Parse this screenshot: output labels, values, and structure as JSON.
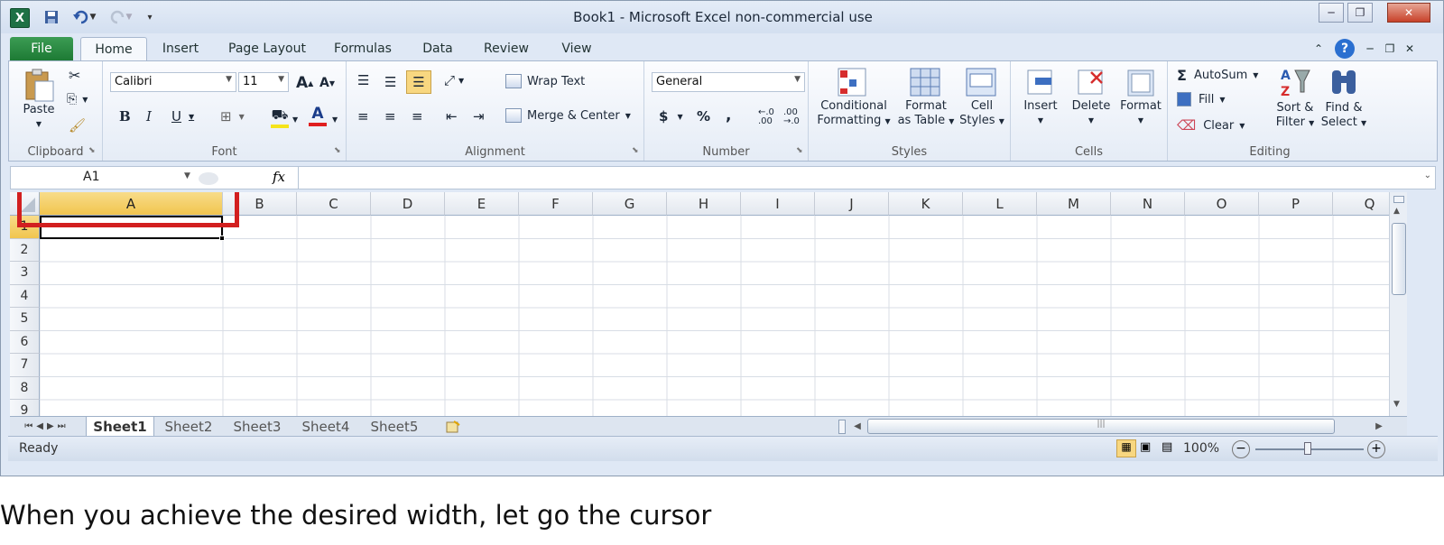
{
  "window": {
    "title": "Book1  -  Microsoft Excel non-commercial use"
  },
  "quick_access": {
    "logo": "X",
    "save_icon": "save-icon",
    "undo_icon": "undo-icon",
    "redo_icon": "redo-icon"
  },
  "tabs": [
    "File",
    "Home",
    "Insert",
    "Page Layout",
    "Formulas",
    "Data",
    "Review",
    "View"
  ],
  "ribbon": {
    "clipboard": {
      "label": "Clipboard",
      "paste": "Paste"
    },
    "font": {
      "label": "Font",
      "name": "Calibri",
      "size": "11",
      "bold": "B",
      "italic": "I",
      "underline": "U",
      "grow": "A",
      "shrink": "A",
      "color_letter": "A"
    },
    "alignment": {
      "label": "Alignment",
      "wrap": "Wrap Text",
      "merge": "Merge & Center"
    },
    "number": {
      "label": "Number",
      "format": "General",
      "currency": "$",
      "percent": "%",
      "comma": ","
    },
    "styles": {
      "label": "Styles",
      "conditional": [
        "Conditional",
        "Formatting"
      ],
      "format_table": [
        "Format",
        "as Table"
      ],
      "cell_styles": [
        "Cell",
        "Styles"
      ]
    },
    "cells": {
      "label": "Cells",
      "insert": "Insert",
      "delete": "Delete",
      "format": "Format"
    },
    "editing": {
      "label": "Editing",
      "autosum": "AutoSum",
      "fill": "Fill",
      "clear": "Clear",
      "sort": [
        "Sort &",
        "Filter"
      ],
      "find": [
        "Find &",
        "Select"
      ]
    }
  },
  "formula_bar": {
    "name_box": "A1",
    "fx": "fx",
    "value": ""
  },
  "grid": {
    "columns": [
      "A",
      "B",
      "C",
      "D",
      "E",
      "F",
      "G",
      "H",
      "I",
      "J",
      "K",
      "L",
      "M",
      "N",
      "O",
      "P",
      "Q"
    ],
    "rows": [
      "1",
      "2",
      "3",
      "4",
      "5",
      "6",
      "7",
      "8",
      "9"
    ],
    "selected_cell": "A1"
  },
  "sheets": [
    "Sheet1",
    "Sheet2",
    "Sheet3",
    "Sheet4",
    "Sheet5"
  ],
  "active_sheet": "Sheet1",
  "status": {
    "ready": "Ready",
    "zoom": "100%"
  },
  "highlight_color": "#d21f1f",
  "caption": "When you achieve the desired width, let go the cursor"
}
